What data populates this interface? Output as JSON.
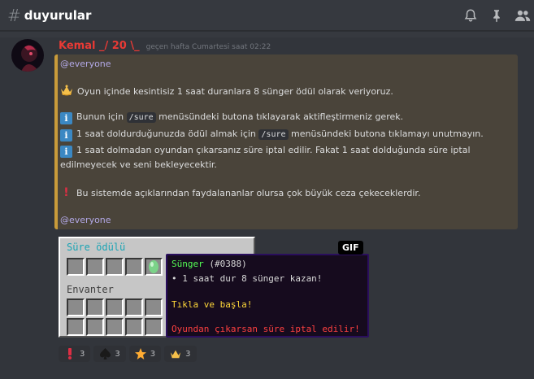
{
  "header": {
    "hash_symbol": "#",
    "channel_name": "duyurular",
    "icons": [
      "bell-icon",
      "pin-icon",
      "members-icon"
    ]
  },
  "message": {
    "username": "Kemal _/ 20 \\_",
    "username_color": "#e83a35",
    "timestamp": "geçen hafta Cumartesi saat 02:22",
    "embed": {
      "border_color": "#c99b3a",
      "mention_top": "@everyone",
      "line1": "Oyun içinde kesintisiz 1 saat duranlara 8 sünger ödül olarak veriyoruz.",
      "line2_a": "Bunun için ",
      "line2_code": "/sure",
      "line2_b": " menüsündeki butona tıklayarak aktifleştirmeniz gerek.",
      "line3_a": "1 saat doldurduğunuzda ödül almak için ",
      "line3_code": "/sure",
      "line3_b": " menüsündeki butona tıklamayı unutmayın.",
      "line4": "1 saat dolmadan oyundan çıkarsanız süre iptal edilir. Fakat 1 saat dolduğunda süre iptal",
      "line5": "edilmeyecek ve seni bekleyecektir.",
      "line6": "Bu sistemde açıklarından faydalananlar olursa çok büyük ceza çekeceklerdir.",
      "mention_bottom": "@everyone"
    },
    "gif": {
      "badge": "GIF",
      "inventory_title": "Süre ödülü",
      "inventory_label": "Envanter",
      "tooltip_item": "Sünger",
      "tooltip_id": "(#0388)",
      "tooltip_line1": "• 1 saat dur 8 sünger kazan!",
      "tooltip_line2": "Tıkla ve başla!",
      "tooltip_line3": "Oyundan çıkarsan süre iptal edilir!"
    },
    "reactions": [
      {
        "emoji": "exclamation-icon",
        "count": "3"
      },
      {
        "emoji": "spade-icon",
        "count": "3"
      },
      {
        "emoji": "star-icon",
        "count": "3"
      },
      {
        "emoji": "crown-icon",
        "count": "3"
      }
    ]
  }
}
